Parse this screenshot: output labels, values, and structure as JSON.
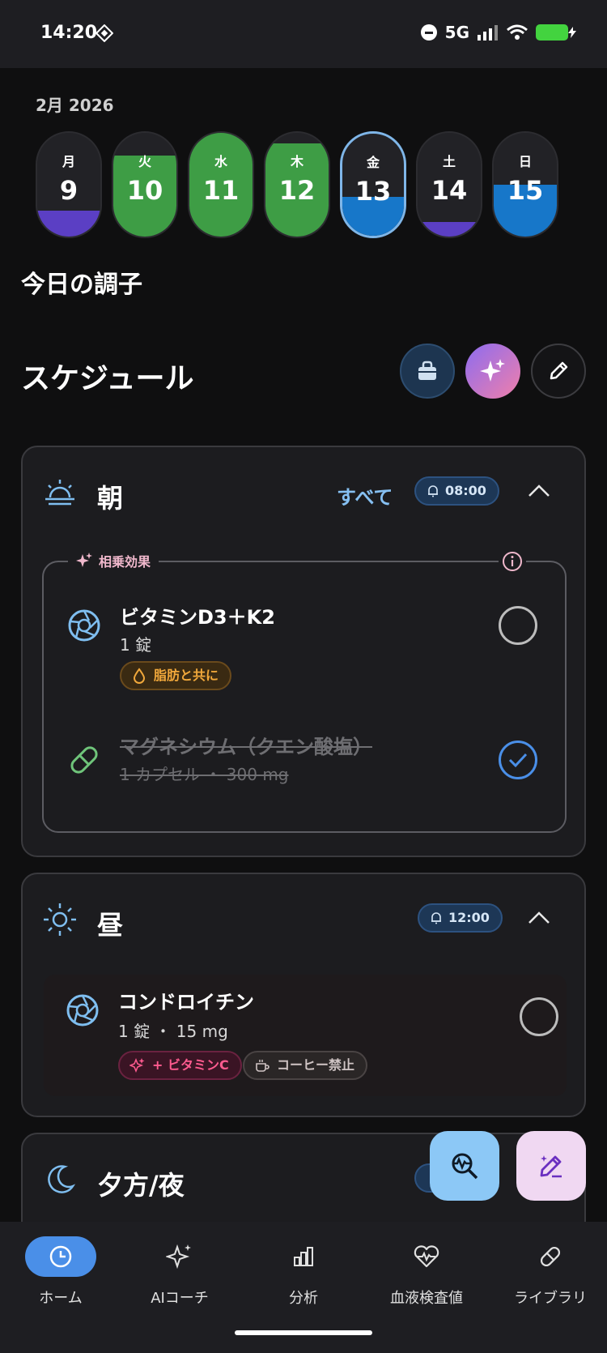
{
  "status_bar": {
    "time": "14:20",
    "network": "5G"
  },
  "calendar": {
    "month_label": "2月 2026",
    "days": [
      {
        "label": "月",
        "num": "9",
        "fill": 0.25,
        "fill_color": "#5b3fc4",
        "state": "partial"
      },
      {
        "label": "火",
        "num": "10",
        "fill": 0.78,
        "fill_color": "#3e9d45",
        "state": "complete"
      },
      {
        "label": "水",
        "num": "11",
        "fill": 1.0,
        "fill_color": "#3e9d45",
        "state": "complete"
      },
      {
        "label": "木",
        "num": "12",
        "fill": 0.9,
        "fill_color": "#3e9d45",
        "state": "complete"
      },
      {
        "label": "金",
        "num": "13",
        "fill": 0.38,
        "fill_color": "#1777c9",
        "state": "selected"
      },
      {
        "label": "土",
        "num": "14",
        "fill": 0.14,
        "fill_color": "#5b3fc4",
        "state": "partial"
      },
      {
        "label": "日",
        "num": "15",
        "fill": 0.5,
        "fill_color": "#1777c9",
        "state": "partial"
      }
    ]
  },
  "condition_title": "今日の調子",
  "schedule": {
    "title": "スケジュール",
    "actions": [
      "shopping-bag-icon",
      "sparkle-icon",
      "pencil-icon"
    ],
    "morning": {
      "name": "朝",
      "all_label": "すべて",
      "time": "08:00",
      "synergy_label": "相乗効果",
      "items": [
        {
          "name": "ビタミンD3＋K2",
          "dose": "1 錠",
          "tag": "脂肪と共に",
          "done": false
        },
        {
          "name": "マグネシウム（クエン酸塩）",
          "dose": "1 カプセル ・ 300 mg",
          "done": true
        }
      ]
    },
    "noon": {
      "name": "昼",
      "time": "12:00",
      "items": [
        {
          "name": "コンドロイチン",
          "dose": "1 錠 ・ 15 mg",
          "tags": [
            "+ ビタミンC",
            "コーヒー禁止"
          ],
          "done": false
        }
      ]
    },
    "evening": {
      "name": "夕方/夜"
    }
  },
  "bottom_nav": [
    {
      "label": "ホーム",
      "active": true
    },
    {
      "label": "AIコーチ",
      "active": false
    },
    {
      "label": "分析",
      "active": false
    },
    {
      "label": "血液検査値",
      "active": false
    },
    {
      "label": "ライブラリ",
      "active": false
    }
  ]
}
